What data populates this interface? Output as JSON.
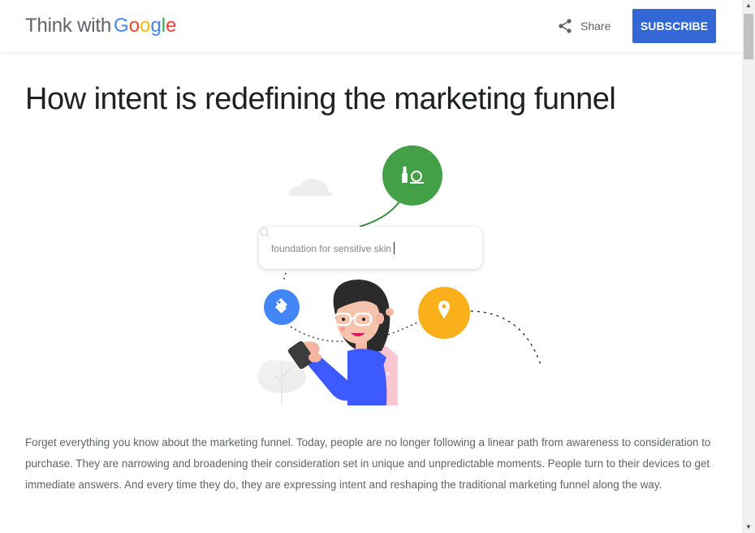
{
  "header": {
    "logo_prefix": "Think with",
    "logo_letters": [
      "G",
      "o",
      "o",
      "g",
      "l",
      "e"
    ],
    "share_label": "Share",
    "subscribe_label": "SUBSCRIBE"
  },
  "article": {
    "title": "How intent is redefining the marketing funnel",
    "search_query": "foundation for sensitive skin",
    "body": "Forget everything you know about the marketing funnel. Today, people are no longer following a linear path from awareness to consideration to purchase. They are narrowing and broadening their consideration set in unique and unpredictable moments. People turn to their devices to get immediate answers. And every time they do, they are expressing intent and reshaping the traditional marketing funnel along the way."
  },
  "illustration": {
    "icons": [
      "cosmetics-icon",
      "price-tag-icon",
      "location-pin-icon",
      "cloud-icon",
      "tree-icon"
    ],
    "colors": {
      "green": "#43a047",
      "blue": "#4285f4",
      "yellow": "#f9b01a",
      "shirt": "#3d5afe",
      "hair": "#2b2b2b"
    }
  },
  "colors": {
    "subscribe_bg": "#3367d6",
    "title_text": "#202124",
    "body_text": "#5f6368"
  }
}
